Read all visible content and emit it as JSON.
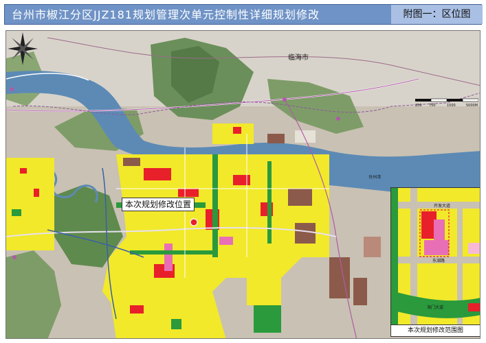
{
  "header": {
    "title": "台州市椒江分区JJZ181规划管理次单元控制性详细规划修改",
    "figure_label": "附图一：区位图"
  },
  "map": {
    "place_labels": {
      "linhai": "临海市",
      "taizhou_bay": "台州湾"
    },
    "site_label": "本次规划修改位置",
    "scale_bar": {
      "ticks": [
        "250",
        "750",
        "1500",
        "5000M"
      ]
    },
    "colors": {
      "water": "#5c8ab5",
      "residential": "#f2e92a",
      "commercial": "#e8202a",
      "green": "#2a9a3c",
      "industrial": "#8c5a4a",
      "farmland": "#c9c1b3",
      "mountain": "#6b8f5a",
      "site_marker": "#e8202a"
    }
  },
  "inset": {
    "caption": "本次规划修改范围图",
    "road_labels": [
      "开发大道",
      "东湖路",
      "海门大道"
    ]
  }
}
